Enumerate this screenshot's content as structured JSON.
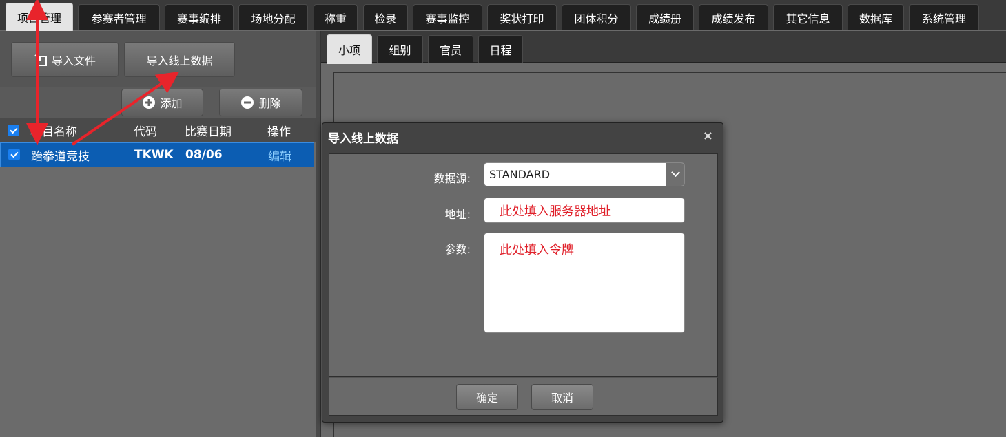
{
  "top_tabs": [
    "项目管理",
    "参赛者管理",
    "赛事编排",
    "场地分配",
    "称重",
    "检录",
    "赛事监控",
    "奖状打印",
    "团体积分",
    "成绩册",
    "成绩发布",
    "其它信息",
    "数据库",
    "系统管理"
  ],
  "left": {
    "import_file_label": "导入文件",
    "import_online_label": "导入线上数据",
    "add_label": "添加",
    "delete_label": "删除",
    "columns": [
      "项目名称",
      "代码",
      "比赛日期",
      "操作"
    ],
    "rows": [
      {
        "name": "跆拳道竞技",
        "code": "TKWK",
        "date": "08/06",
        "action": "编辑"
      }
    ]
  },
  "sub_tabs": [
    "小项",
    "组别",
    "官员",
    "日程"
  ],
  "dialog": {
    "title": "导入线上数据",
    "close": "×",
    "datasource_label": "数据源:",
    "datasource_value": "STANDARD",
    "address_label": "地址:",
    "address_value": "此处填入服务器地址",
    "params_label": "参数:",
    "params_value": "此处填入令牌",
    "ok_label": "确定",
    "cancel_label": "取消"
  },
  "colors": {
    "annotation": "#e8242b",
    "selected_row": "#0c5db2",
    "link": "#8fd0ff"
  }
}
